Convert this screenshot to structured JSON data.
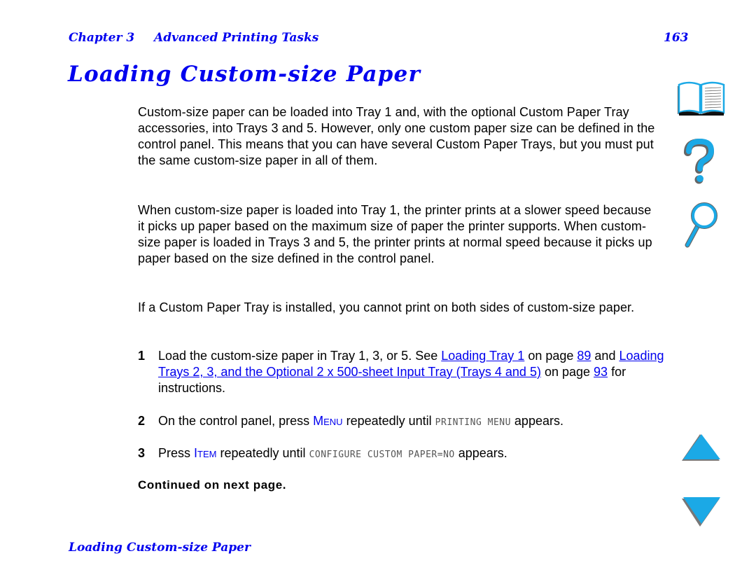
{
  "header": {
    "chapter": "Chapter 3",
    "section": "Advanced Printing Tasks",
    "page_number": "163"
  },
  "title": "Loading Custom-size Paper",
  "paragraphs": [
    "Custom-size paper can be loaded into Tray 1 and, with the optional Custom Paper Tray accessories, into Trays 3 and 5. However, only one custom paper size can be defined in the control panel. This means that you can have several Custom Paper Trays, but you must put the same custom-size paper in all of them.",
    "When custom-size paper is loaded into Tray 1, the printer prints at a slower speed because it picks up paper based on the maximum size of paper the printer supports. When custom-size paper is loaded in Trays 3 and 5, the printer prints at normal speed because it picks up paper based on the size defined in the control panel.",
    "If a Custom Paper Tray is installed, you cannot print on both sides of custom-size paper."
  ],
  "steps": [
    {
      "number": "1",
      "t1": "Load the custom-size paper in Tray 1, 3, or 5. See ",
      "link1": "Loading Tray 1",
      "t2": " on page ",
      "link2": "89",
      "t3": " and ",
      "link3": "Loading Trays 2, 3, and the Optional 2 x 500-sheet Input Tray (Trays 4 and 5)",
      "t4": " on page ",
      "link4": "93",
      "t5": " for instructions."
    },
    {
      "number": "2",
      "t1": "On the control panel, press ",
      "key": "Menu",
      "t2": " repeatedly until ",
      "lcd": "PRINTING MENU",
      "t3": " appears."
    },
    {
      "number": "3",
      "t1": "Press ",
      "key": "Item",
      "t2": " repeatedly until ",
      "lcd": "CONFIGURE CUSTOM PAPER=NO",
      "t3": " appears."
    }
  ],
  "continued": "Continued on next page.",
  "footer": "Loading Custom-size Paper",
  "nav_icons": {
    "contents": "book-icon",
    "help": "question-mark-icon",
    "search": "magnifier-icon",
    "previous": "up-triangle-icon",
    "next": "down-triangle-icon"
  },
  "colors": {
    "link": "#0000ee",
    "icon_fill": "#1ba9e6",
    "icon_shadow": "#777777"
  }
}
